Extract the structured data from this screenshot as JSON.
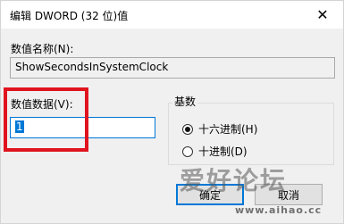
{
  "window": {
    "title": "编辑 DWORD (32 位)值",
    "close_glyph": "✕"
  },
  "value_name": {
    "label": "数值名称(N):",
    "value": "ShowSecondsInSystemClock"
  },
  "value_data": {
    "label": "数值数据(V):",
    "value": "1"
  },
  "base": {
    "title": "基数",
    "options": [
      {
        "label": "十六进制(H)",
        "checked": true
      },
      {
        "label": "十进制(D)",
        "checked": false
      }
    ]
  },
  "buttons": {
    "ok": "确定",
    "cancel": "取消"
  },
  "watermark": {
    "text": "爱好论坛",
    "url": "www.aihao.cc"
  },
  "colors": {
    "highlight": "#e0141e",
    "selection": "#0078d7"
  }
}
